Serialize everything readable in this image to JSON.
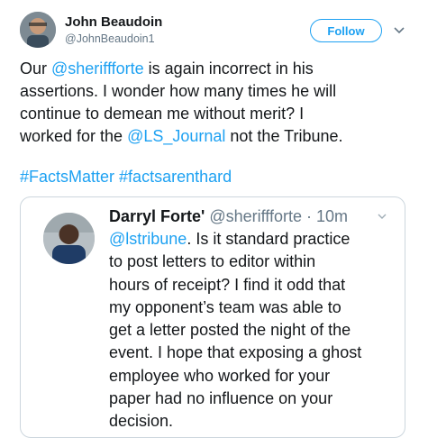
{
  "tweet": {
    "author_name": "John Beaudoin",
    "author_handle": "@JohnBeaudoin1",
    "follow_label": "Follow",
    "body_lines": [
      {
        "pre": "Our ",
        "link": "@sheriffforte",
        "post": " is again incorrect in his"
      },
      {
        "pre": "assertions. I wonder how many times he will",
        "link": "",
        "post": ""
      },
      {
        "pre": "continue to demean me without merit? I",
        "link": "",
        "post": ""
      },
      {
        "pre": "worked for the ",
        "link": "@LS_Journal",
        "post": " not the Tribune."
      }
    ],
    "hashtags": [
      "#FactsMatter",
      "#factsarenthard"
    ]
  },
  "quoted_tweet": {
    "author_name": "Darryl Forte'",
    "author_handle": "@sheriffforte",
    "separator": " · ",
    "time": "10m",
    "lines": [
      {
        "link": "@lstribune",
        "text": ". Is it standard practice"
      },
      {
        "link": "",
        "text": "to post letters to editor within"
      },
      {
        "link": "",
        "text": "hours of receipt? I find it odd that"
      },
      {
        "link": "",
        "text": "my opponent’s team was able to"
      },
      {
        "link": "",
        "text": "get a letter posted the night of the"
      },
      {
        "link": "",
        "text": "event. I hope that exposing a ghost"
      },
      {
        "link": "",
        "text": "employee who worked for your"
      },
      {
        "link": "",
        "text": "paper had no influence on your"
      },
      {
        "link": "",
        "text": "decision."
      }
    ]
  },
  "colors": {
    "link": "#1da1f2",
    "text": "#14171a",
    "muted": "#657786",
    "border": "#ccd6dd"
  },
  "icons": {
    "menu_caret": "chevron-down-icon"
  }
}
